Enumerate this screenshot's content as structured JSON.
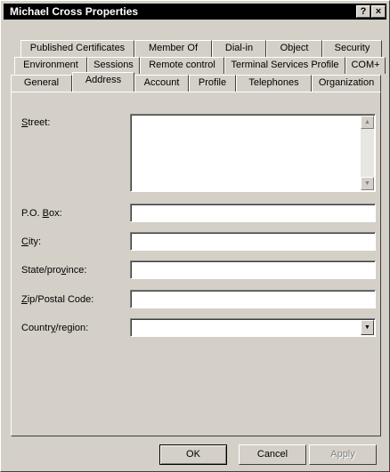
{
  "window": {
    "title": "Michael Cross Properties"
  },
  "titlebar": {
    "help_glyph": "?",
    "close_glyph": "×"
  },
  "tabs": {
    "row1": [
      "Published Certificates",
      "Member Of",
      "Dial-in",
      "Object",
      "Security"
    ],
    "row2": [
      "Environment",
      "Sessions",
      "Remote control",
      "Terminal Services Profile",
      "COM+"
    ],
    "row3": [
      "General",
      "Address",
      "Account",
      "Profile",
      "Telephones",
      "Organization"
    ],
    "active": "Address"
  },
  "form": {
    "street": {
      "label_pre": "",
      "label_key": "S",
      "label_post": "treet:",
      "value": ""
    },
    "po_box": {
      "label_pre": "P.O. ",
      "label_key": "B",
      "label_post": "ox:",
      "value": ""
    },
    "city": {
      "label_pre": "",
      "label_key": "C",
      "label_post": "ity:",
      "value": ""
    },
    "state": {
      "label_pre": "State/pro",
      "label_key": "v",
      "label_post": "ince:",
      "value": ""
    },
    "zip": {
      "label_pre": "",
      "label_key": "Z",
      "label_post": "ip/Postal Code:",
      "value": ""
    },
    "country": {
      "label_pre": "Countr",
      "label_key": "y",
      "label_post": "/region:",
      "selected": ""
    }
  },
  "buttons": {
    "ok": "OK",
    "cancel": "Cancel",
    "apply": "Apply"
  },
  "icons": {
    "scroll_up": "▲",
    "scroll_down": "▼",
    "dropdown": "▼"
  }
}
